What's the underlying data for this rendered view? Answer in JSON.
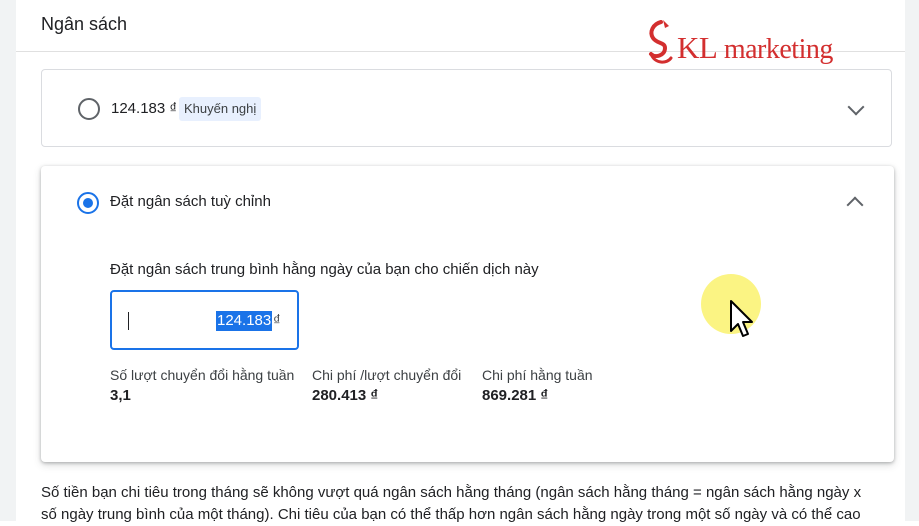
{
  "page": {
    "title": "Ngân sách"
  },
  "logo": {
    "text_kl": "KL",
    "text_rest": " marketing"
  },
  "option_recommended": {
    "amount": "124.183 ₫",
    "badge": "Khuyến nghị"
  },
  "option_custom": {
    "label": "Đặt ngân sách tuỳ chỉnh",
    "instruction": "Đặt ngân sách trung bình hằng ngày của bạn cho chiến dịch này",
    "input_value": "124.183",
    "input_currency": "₫"
  },
  "stats": [
    {
      "label": "Số lượt chuyển đổi hằng tuần",
      "value": "3,1"
    },
    {
      "label": "Chi phí /lượt chuyển đổi",
      "value": "280.413 ₫"
    },
    {
      "label": "Chi phí hằng tuần",
      "value": "869.281 ₫"
    }
  ],
  "footer": {
    "line1": "Số tiền bạn chi tiêu trong tháng sẽ không vượt quá ngân sách hằng tháng (ngân sách hằng tháng = ngân sách hằng ngày x",
    "line2": "số ngày trung bình của một tháng). Chi tiêu của bạn có thể thấp hơn ngân sách hằng ngày trong một số ngày và có thể cao"
  },
  "colors": {
    "accent": "#1a73e8",
    "logo": "#d32f2f",
    "badge_bg": "#e8f0fe"
  }
}
